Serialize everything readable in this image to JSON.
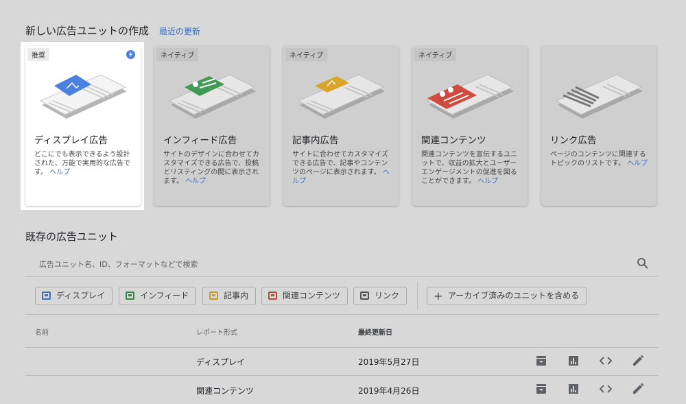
{
  "new_section": {
    "title": "新しい広告ユニットの作成",
    "recent_link": "最近の更新"
  },
  "cards": [
    {
      "tag": "推奨",
      "title": "ディスプレイ広告",
      "desc": "どこにでも表示できるよう設計された、万能で実用的な広告です。",
      "help": "ヘルプ",
      "accent": "#4a80e0"
    },
    {
      "tag": "ネイティブ",
      "title": "インフィード広告",
      "desc": "サイトのデザインに合わせてカスタマイズできる広告で、投稿とリスティングの間に表示されます。",
      "help": "ヘルプ",
      "accent": "#3e9a55"
    },
    {
      "tag": "ネイティブ",
      "title": "記事内広告",
      "desc": "サイトに合わせてカスタマイズできる広告で、記事やコンテンツのページに表示されます。",
      "help": "ヘルプ",
      "accent": "#d9a52a"
    },
    {
      "tag": "ネイティブ",
      "title": "関連コンテンツ",
      "desc": "関連コンテンツを宣伝するユニットで、収益の拡大とユーザー エンゲージメントの促進を図ることができます。",
      "help": "ヘルプ",
      "accent": "#d04b3f"
    },
    {
      "tag": "",
      "title": "リンク広告",
      "desc": "ページのコンテンツに関連するトピックのリストです。",
      "help": "ヘルプ",
      "accent": "#777777"
    }
  ],
  "existing_section": {
    "title": "既存の広告ユニット",
    "search_placeholder": "広告ユニット名、ID、フォーマットなどで検索"
  },
  "filters": [
    {
      "label": "ディスプレイ",
      "color": "#3b6fc4"
    },
    {
      "label": "インフィード",
      "color": "#2f8a4a"
    },
    {
      "label": "記事内",
      "color": "#c99a22"
    },
    {
      "label": "関連コンテンツ",
      "color": "#c0453a"
    },
    {
      "label": "リンク",
      "color": "#555555"
    }
  ],
  "archive_chip": "アーカイブ済みのユニットを含める",
  "table": {
    "headers": {
      "name": "名前",
      "report_format": "レポート形式",
      "last_updated": "最終更新日"
    },
    "rows": [
      {
        "name": "",
        "report_format": "ディスプレイ",
        "last_updated": "2019年5月27日"
      },
      {
        "name": "",
        "report_format": "関連コンテンツ",
        "last_updated": "2019年4月26日"
      }
    ]
  },
  "icons": [
    "archive-icon",
    "bar-chart-icon",
    "code-icon",
    "edit-icon",
    "search-icon",
    "bolt-icon",
    "plus-icon"
  ]
}
